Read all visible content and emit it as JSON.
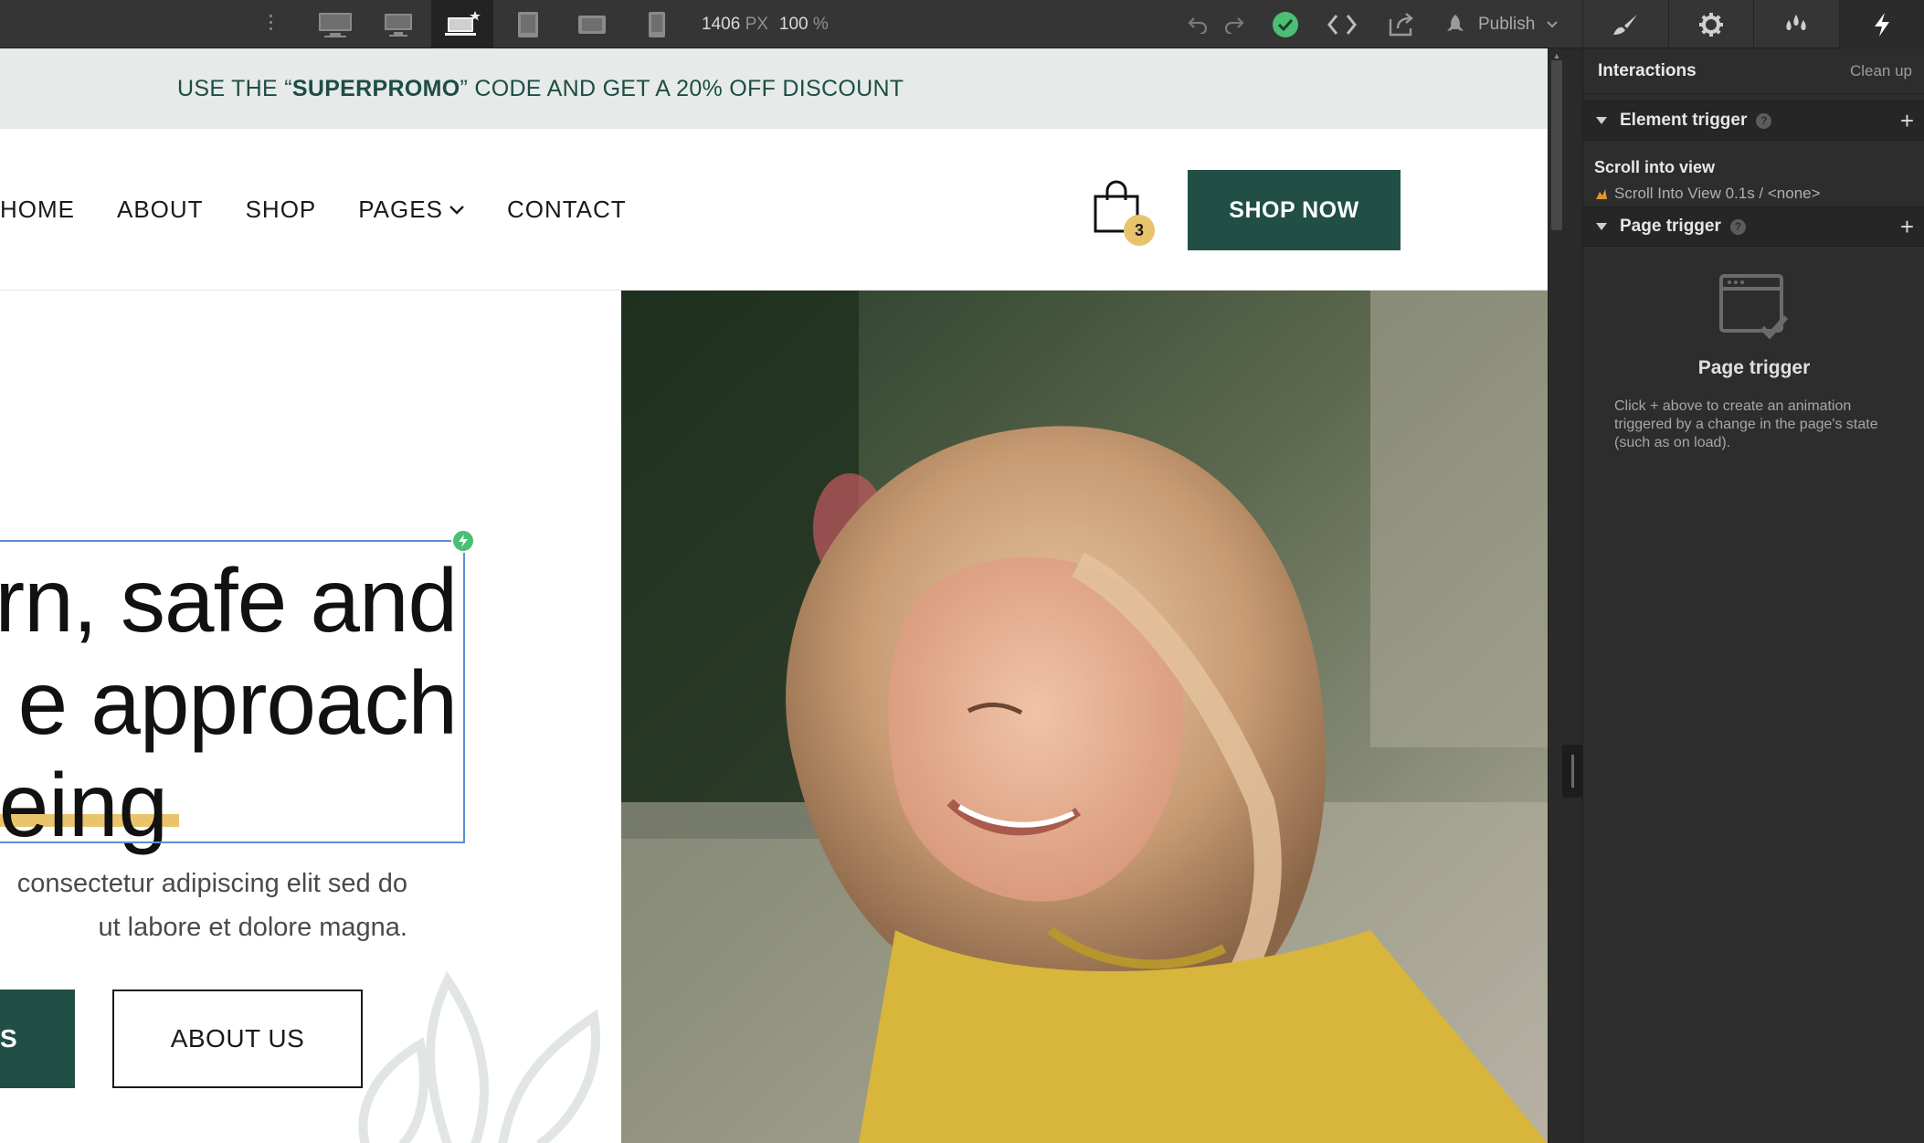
{
  "toolbar": {
    "width_value": "1406",
    "width_unit": "PX",
    "zoom_value": "100",
    "zoom_unit": "%",
    "publish_label": "Publish"
  },
  "promo": {
    "prefix": "USE THE “",
    "code": "SUPERPROMO",
    "suffix": "” CODE AND GET A 20% OFF DISCOUNT"
  },
  "nav": {
    "items": [
      "HOME",
      "ABOUT",
      "SHOP",
      "PAGES",
      "CONTACT"
    ],
    "cart_count": "3",
    "shop_now_label": "SHOP NOW"
  },
  "hero": {
    "headline_line1": "rn, safe and",
    "headline_line2": "e approach",
    "headline_line3": "eing",
    "paragraph_line1": "consectetur adipiscing elit sed do",
    "paragraph_line2": "ut labore et dolore magna.",
    "primary_button_label": "S",
    "secondary_button_label": "ABOUT US"
  },
  "panel": {
    "title": "Interactions",
    "clean_up_label": "Clean up",
    "element_trigger_label": "Element trigger",
    "trigger_item_title": "Scroll into view",
    "trigger_item_detail": "Scroll Into View 0.1s / <none>",
    "page_trigger_label": "Page trigger",
    "empty_title": "Page trigger",
    "empty_description": "Click + above to create an animation triggered by a change in the page's state (such as on load)."
  },
  "colors": {
    "brand_green": "#214f45",
    "accent_yellow": "#e7c46c",
    "selection_blue": "#5a8fd8",
    "status_green": "#4bbf73"
  }
}
